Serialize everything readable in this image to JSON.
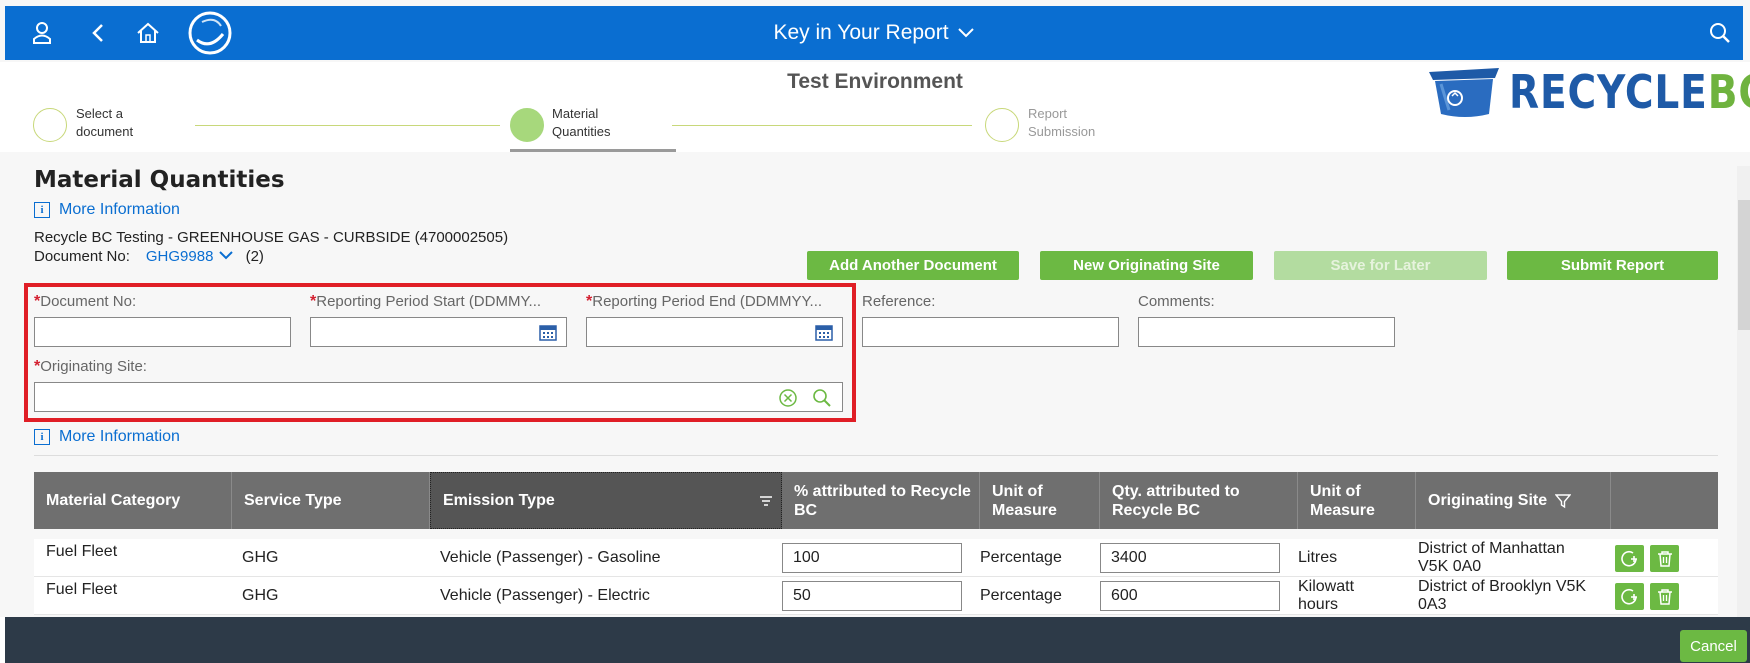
{
  "shell": {
    "title": "Key in Your Report"
  },
  "header": {
    "environment": "Test Environment",
    "logo": "RECYCLEBC",
    "steps": [
      {
        "line1": "Select a",
        "line2": "document",
        "state": "done"
      },
      {
        "line1": "Material",
        "line2": "Quantities",
        "state": "current"
      },
      {
        "line1": "Report",
        "line2": "Submission",
        "state": "pending"
      }
    ]
  },
  "page": {
    "title": "Material Quantities",
    "more_info": "More Information",
    "document_name": "Recycle BC Testing - GREENHOUSE GAS - CURBSIDE (4700002505)",
    "doc_no_label": "Document No:",
    "doc_no_value": "GHG9988",
    "doc_count": "(2)"
  },
  "actions": {
    "add_document": "Add Another Document",
    "new_site": "New Originating Site",
    "save_later": "Save for Later",
    "submit": "Submit Report"
  },
  "form": {
    "document_no": {
      "label": "Document No:",
      "value": ""
    },
    "period_start": {
      "label": "Reporting Period Start (DDMMY...",
      "value": ""
    },
    "period_end": {
      "label": "Reporting Period End (DDMMYY...",
      "value": ""
    },
    "reference": {
      "label": "Reference:",
      "value": ""
    },
    "comments": {
      "label": "Comments:",
      "value": ""
    },
    "originating_site": {
      "label": "Originating Site:",
      "value": ""
    }
  },
  "table": {
    "headers": [
      "Material Category",
      "Service Type",
      "Emission Type",
      "% attributed to Recycle BC",
      "Unit of Measure",
      "Qty. attributed to Recycle BC",
      "Unit of Measure",
      "Originating Site"
    ],
    "rows": [
      {
        "category": "Fuel Fleet",
        "service": "GHG",
        "emission": "Vehicle (Passenger) - Gasoline",
        "pct": "100",
        "pct_unit": "Percentage",
        "qty": "3400",
        "qty_unit": "Litres",
        "site": "District of Manhattan V5K 0A0"
      },
      {
        "category": "Fuel Fleet",
        "service": "GHG",
        "emission": "Vehicle (Passenger) - Electric",
        "pct": "50",
        "pct_unit": "Percentage",
        "qty": "600",
        "qty_unit": "Kilowatt hours",
        "site": "District of Brooklyn V5K 0A3"
      }
    ]
  },
  "footer": {
    "cancel": "Cancel"
  },
  "colors": {
    "shell_blue": "#0a6ed1",
    "action_green": "#6cb943",
    "required_red": "#d32030",
    "highlight_red": "#e01e26"
  },
  "icons": [
    "user-icon",
    "back-icon",
    "home-icon",
    "app-logo-icon",
    "chevron-down-icon",
    "search-icon",
    "info-icon",
    "calendar-icon",
    "clear-icon",
    "filter-icon",
    "sort-icon",
    "copy-row-icon",
    "delete-icon"
  ]
}
